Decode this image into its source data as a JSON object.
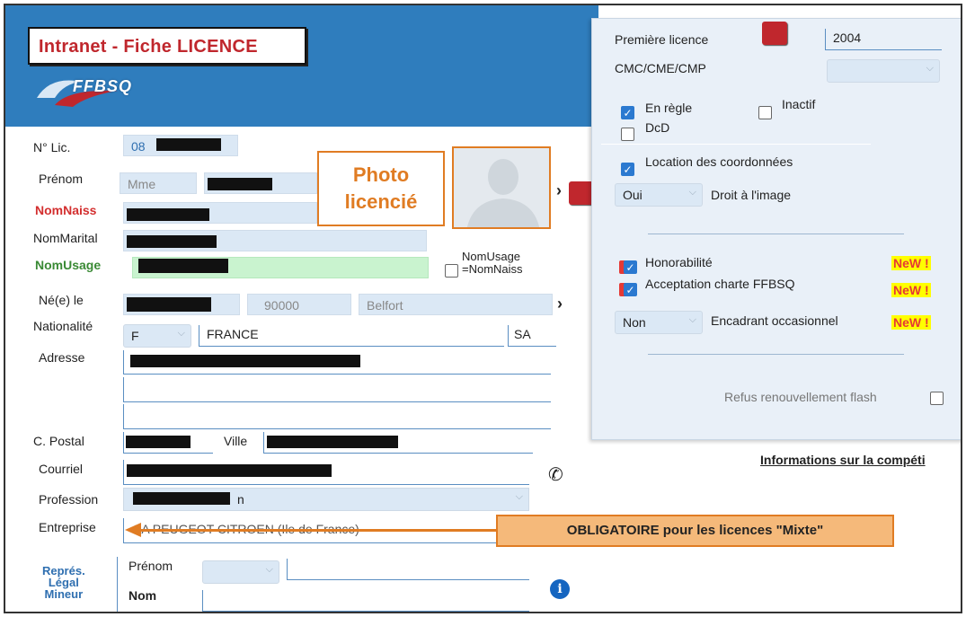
{
  "header": {
    "title": "Intranet - Fiche LICENCE",
    "logo_text": "FFBSQ"
  },
  "form": {
    "num_lic_label": "N° Lic.",
    "num_lic_value": "08",
    "prenom_label": "Prénom",
    "civilite_value": "Mme",
    "nomnaiss_label": "NomNaiss",
    "nommarital_label": "NomMarital",
    "nomusage_label": "NomUsage",
    "nomusage_eq_label": "NomUsage\n=NomNaiss",
    "ne_le_label": "Né(e) le",
    "cp_naissance": "90000",
    "ville_naissance": "Belfort",
    "nationalite_label": "Nationalité",
    "nationalite_code": "F",
    "nationalite_value": "FRANCE",
    "nationalite_suffix": "SA",
    "adresse_label": "Adresse",
    "cpostal_label": "C. Postal",
    "ville_label": "Ville",
    "courriel_label": "Courriel",
    "profession_label": "Profession",
    "profession_suffix": "n",
    "entreprise_label": "Entreprise",
    "entreprise_value": "SA PEUGEOT CITROEN (Ile de France)",
    "repres_label": "Représ.\nLégal\nMineur",
    "repres_prenom_label": "Prénom",
    "repres_nom_label": "Nom"
  },
  "annotations": {
    "photo_label": "Photo licencié",
    "obligatoire": "OBLIGATOIRE pour les licences \"Mixte\""
  },
  "panel": {
    "premiere_licence_label": "Première licence",
    "premiere_licence_value": "2004",
    "cmc_label": "CMC/CME/CMP",
    "en_regle_label": "En règle",
    "inactif_label": "Inactif",
    "dcd_label": "DcD",
    "location_label": "Location des coordonnées",
    "droit_image_value": "Oui",
    "droit_image_label": "Droit à l'image",
    "honorabilite_label": "Honorabilité",
    "acceptation_label": "Acceptation charte FFBSQ",
    "encadrant_value": "Non",
    "encadrant_label": "Encadrant occasionnel",
    "new_badge": "NeW !",
    "refus_label": "Refus renouvellement flash"
  },
  "info_link": "Informations sur la compéti",
  "colors": {
    "header_blue": "#2f7dbd",
    "title_red": "#c0272d",
    "annotation_orange": "#e07c23",
    "new_yellow": "#ffff00"
  }
}
